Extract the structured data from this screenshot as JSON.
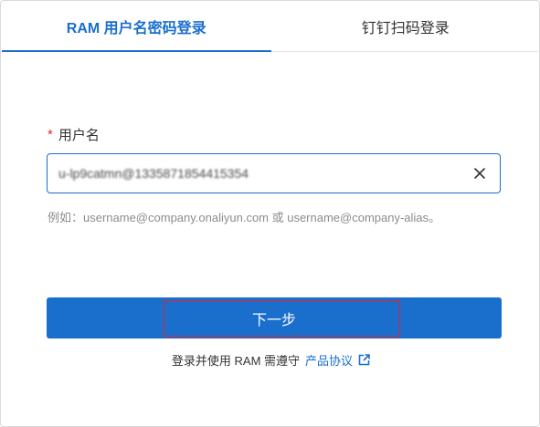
{
  "tabs": [
    {
      "label": "RAM 用户名密码登录",
      "active": true
    },
    {
      "label": "钉钉扫码登录",
      "active": false
    }
  ],
  "form": {
    "required_mark": "*",
    "username_label": "用户名",
    "username_value": "u-lp9catmn@1335871854415354",
    "clear_icon": "close-icon",
    "hint": "例如：username@company.onaliyun.com 或 username@company-alias。"
  },
  "next_button": {
    "label": "下一步"
  },
  "agreement": {
    "text": "登录并使用 RAM 需遵守",
    "link_text": "产品协议",
    "link_icon": "external-link-icon"
  },
  "colors": {
    "accent": "#1a6fcc",
    "required": "#d93026",
    "highlight": "#e8212e"
  }
}
